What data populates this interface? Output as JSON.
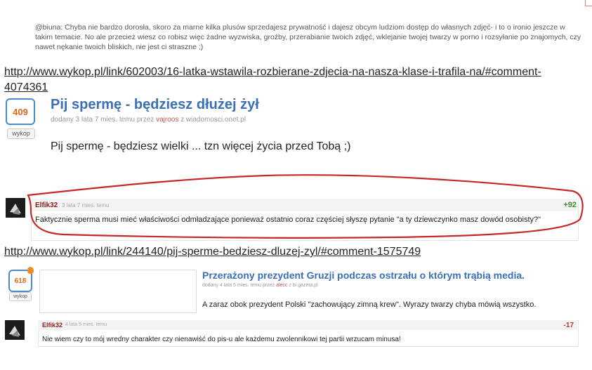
{
  "top_comment": {
    "text": "@biuna: Chyba nie bardzo dorosła, skoro za marne kilka plusów sprzedajesz prywatność i dajesz obcym ludziom dostęp do własnych zdjęć- i to o ironio jeszcze w takim temacie. No ale przecież wiesz co robisz więc żadne wyzwiska, groźby, przerabianie twoich zdjęć, wklejanie twojej twarzy w porno i rozsyłanie po znajomych, czy nawet nękanie twoich bliskich, nie jest ci straszne ;)"
  },
  "link1": "http://www.wykop.pl/link/602003/16-latka-wstawila-rozbierane-zdjecia-na-nasza-klase-i-trafila-na/#comment-4074361",
  "entry1": {
    "votes": "409",
    "wykop_label": "wykop",
    "title": "Pij spermę - będziesz dłużej żył",
    "meta_prefix": "dodany 3 lata 7 mies. temu przez ",
    "meta_user": "vajroos",
    "meta_suffix": " z wiadomosci.onet.pl",
    "body": "Pij spermę - będziesz wielki ... tzn więcej życia przed Tobą ;)"
  },
  "comment1": {
    "user": "Elfik32",
    "time": "3 lata 7 mies. temu",
    "score": "+92",
    "text": "Faktycznie sperma musi mieć właściwości odmładzające ponieważ ostatnio coraz częściej słyszę pytanie \"a ty dziewczynko masz dowód osobisty?\""
  },
  "link2": "http://www.wykop.pl/link/244140/pij-sperme-bedziesz-dluzej-zyl/#comment-1575749",
  "entry2": {
    "votes": "618",
    "wykop_label": "wykop",
    "title": "Przerażony prezydent Gruzji podczas ostrzału o którym trąbią media.",
    "meta_prefix": "dodany 4 lata 5 mies. temu przez ",
    "meta_user": "alecc",
    "meta_suffix": " z bi.gazeta.pl",
    "body": "A zaraz obok prezydent Polski \"zachowujący zimną krew\". Wyrazy twarzy chyba mówią wszystko."
  },
  "comment2": {
    "user": "Elfik32",
    "time": "4 lata 5 mies. temu",
    "score": "-17",
    "text": "Nie wiem czy to mój wredny charakter czy nienawiść do pis-u ale każdemu zwolennikowi tej partii wrzucam minusa!"
  },
  "colors": {
    "title": "#3b6fb6",
    "vote_border": "#4a8ccb",
    "vote_text": "#e0651b",
    "highlight_outline": "#c62828",
    "positive_score": "#3c8a2e",
    "negative_score": "#c0392b"
  }
}
